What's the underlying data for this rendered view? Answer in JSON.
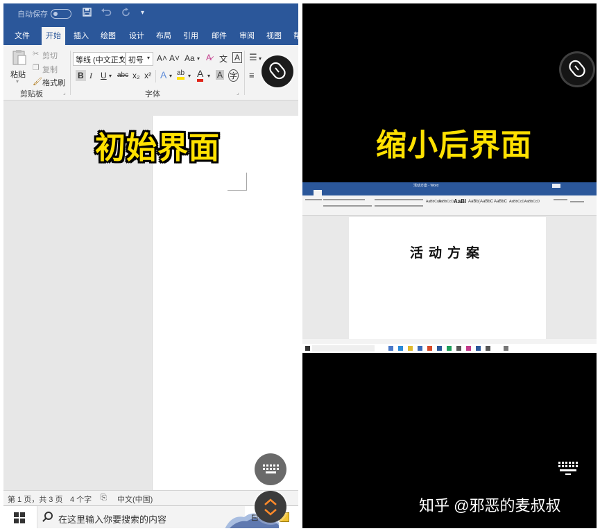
{
  "left_panel": {
    "caption": "初始界面",
    "quick_access": {
      "autosave_label": "自动保存"
    },
    "tabs": [
      {
        "label": "文件"
      },
      {
        "label": "开始",
        "active": true
      },
      {
        "label": "插入"
      },
      {
        "label": "绘图"
      },
      {
        "label": "设计"
      },
      {
        "label": "布局"
      },
      {
        "label": "引用"
      },
      {
        "label": "邮件"
      },
      {
        "label": "审阅"
      },
      {
        "label": "视图"
      },
      {
        "label": "帮"
      }
    ],
    "ribbon": {
      "paste_label": "粘贴",
      "cut_label": "剪切",
      "copy_label": "复制",
      "format_painter_label": "格式刷",
      "font_name": "等线 (中文正文",
      "font_size": "初号",
      "clipboard_group": "剪贴板",
      "font_group": "字体",
      "bold": "B",
      "italic": "I",
      "underline": "U",
      "strike": "abc",
      "subscript": "x₂",
      "superscript": "x²",
      "grow_font": "A˄",
      "shrink_font": "A˅",
      "change_case": "Aa",
      "text_effect": "A",
      "highlight": "ab",
      "font_color": "A",
      "char_shading": "A",
      "enclosed_char": "字",
      "pinyin": "文",
      "char_border": "A"
    },
    "status_bar": {
      "page": "第 1 页，共 3 页",
      "words": "4 个字",
      "language": "中文(中国)"
    },
    "taskbar": {
      "search_placeholder": "在这里输入你要搜索的内容"
    },
    "colors": {
      "ribbon_blue": "#2b579a",
      "caption_yellow": "#ffe100"
    }
  },
  "right_panel": {
    "caption": "缩小后界面",
    "mini_document": {
      "heading": "活动方案",
      "styles": [
        "AaBbCcD",
        "AaBbCcD",
        "AaBl",
        "AaBb(",
        "AaBbC",
        "AaBbC",
        "AaBbCcD",
        "AaBbCcD"
      ],
      "window_title": "活动方案 - Word"
    },
    "watermark": "知乎 @邪恶的麦叔叔"
  }
}
